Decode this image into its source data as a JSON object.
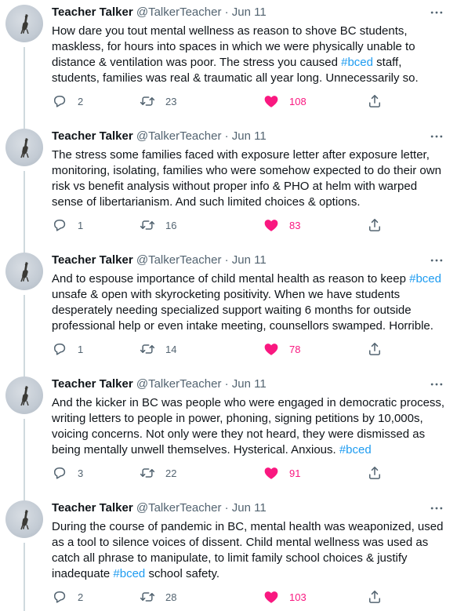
{
  "tweets": [
    {
      "name": "Teacher Talker",
      "handle": "@TalkerTeacher",
      "dot": "·",
      "date": "Jun 11",
      "lines": [
        [
          {
            "t": "How dare you tout mental wellness as reason to shove BC students,"
          }
        ],
        [
          {
            "t": "maskless, for hours into spaces in which we were physically unable to"
          }
        ],
        [
          {
            "t": "distance & ventilation was poor. The stress you caused "
          },
          {
            "t": "#bced",
            "tag": true
          },
          {
            "t": " staff,"
          }
        ],
        [
          {
            "t": "students, families was real & traumatic all year long. Unnecessarily so."
          }
        ]
      ],
      "replies": "2",
      "retweets": "23",
      "likes": "108"
    },
    {
      "name": "Teacher Talker",
      "handle": "@TalkerTeacher",
      "dot": "·",
      "date": "Jun 11",
      "lines": [
        [
          {
            "t": "The stress some families faced with exposure letter after exposure letter,"
          }
        ],
        [
          {
            "t": "monitoring, isolating, families who were somehow expected to do their own"
          }
        ],
        [
          {
            "t": "risk vs benefit analysis without proper info & PHO at helm with warped"
          }
        ],
        [
          {
            "t": "sense of libertarianism. And such limited choices & options."
          }
        ]
      ],
      "replies": "1",
      "retweets": "16",
      "likes": "83"
    },
    {
      "name": "Teacher Talker",
      "handle": "@TalkerTeacher",
      "dot": "·",
      "date": "Jun 11",
      "lines": [
        [
          {
            "t": "And to espouse importance of child mental health as reason to keep "
          },
          {
            "t": "#bced",
            "tag": true
          }
        ],
        [
          {
            "t": "unsafe & open with skyrocketing positivity. When we have students"
          }
        ],
        [
          {
            "t": "desperately needing specialized support waiting 6 months for outside"
          }
        ],
        [
          {
            "t": "professional help or even intake meeting, counsellors swamped. Horrible."
          }
        ]
      ],
      "replies": "1",
      "retweets": "14",
      "likes": "78"
    },
    {
      "name": "Teacher Talker",
      "handle": "@TalkerTeacher",
      "dot": "·",
      "date": "Jun 11",
      "lines": [
        [
          {
            "t": "And the kicker in BC was people who were engaged in democratic process,"
          }
        ],
        [
          {
            "t": "writing letters to people in power, phoning, signing petitions by 10,000s,"
          }
        ],
        [
          {
            "t": "voicing concerns. Not only were they not heard, they were dismissed as"
          }
        ],
        [
          {
            "t": "being mentally unwell themselves. Hysterical. Anxious. "
          },
          {
            "t": "#bced",
            "tag": true
          }
        ]
      ],
      "replies": "3",
      "retweets": "22",
      "likes": "91"
    },
    {
      "name": "Teacher Talker",
      "handle": "@TalkerTeacher",
      "dot": "·",
      "date": "Jun 11",
      "lines": [
        [
          {
            "t": "During the course of pandemic in BC, mental health was weaponized, used"
          }
        ],
        [
          {
            "t": "as a tool to silence voices of dissent. Child mental wellness was used as"
          }
        ],
        [
          {
            "t": "catch all phrase to manipulate, to limit family school choices & justify"
          }
        ],
        [
          {
            "t": "inadequate "
          },
          {
            "t": "#bced",
            "tag": true
          },
          {
            "t": " school safety."
          }
        ]
      ],
      "replies": "2",
      "retweets": "28",
      "likes": "103"
    }
  ],
  "colors": {
    "text": "#0f1419",
    "secondary": "#536471",
    "hashtag": "#1d9bf0",
    "like": "#f91880",
    "thread_line": "#cfd9de"
  },
  "icons": {
    "reply": "reply-icon",
    "retweet": "retweet-icon",
    "like": "heart-filled-icon",
    "share": "share-icon",
    "more": "more-dots-icon",
    "avatar": "bird-silhouette-avatar"
  }
}
